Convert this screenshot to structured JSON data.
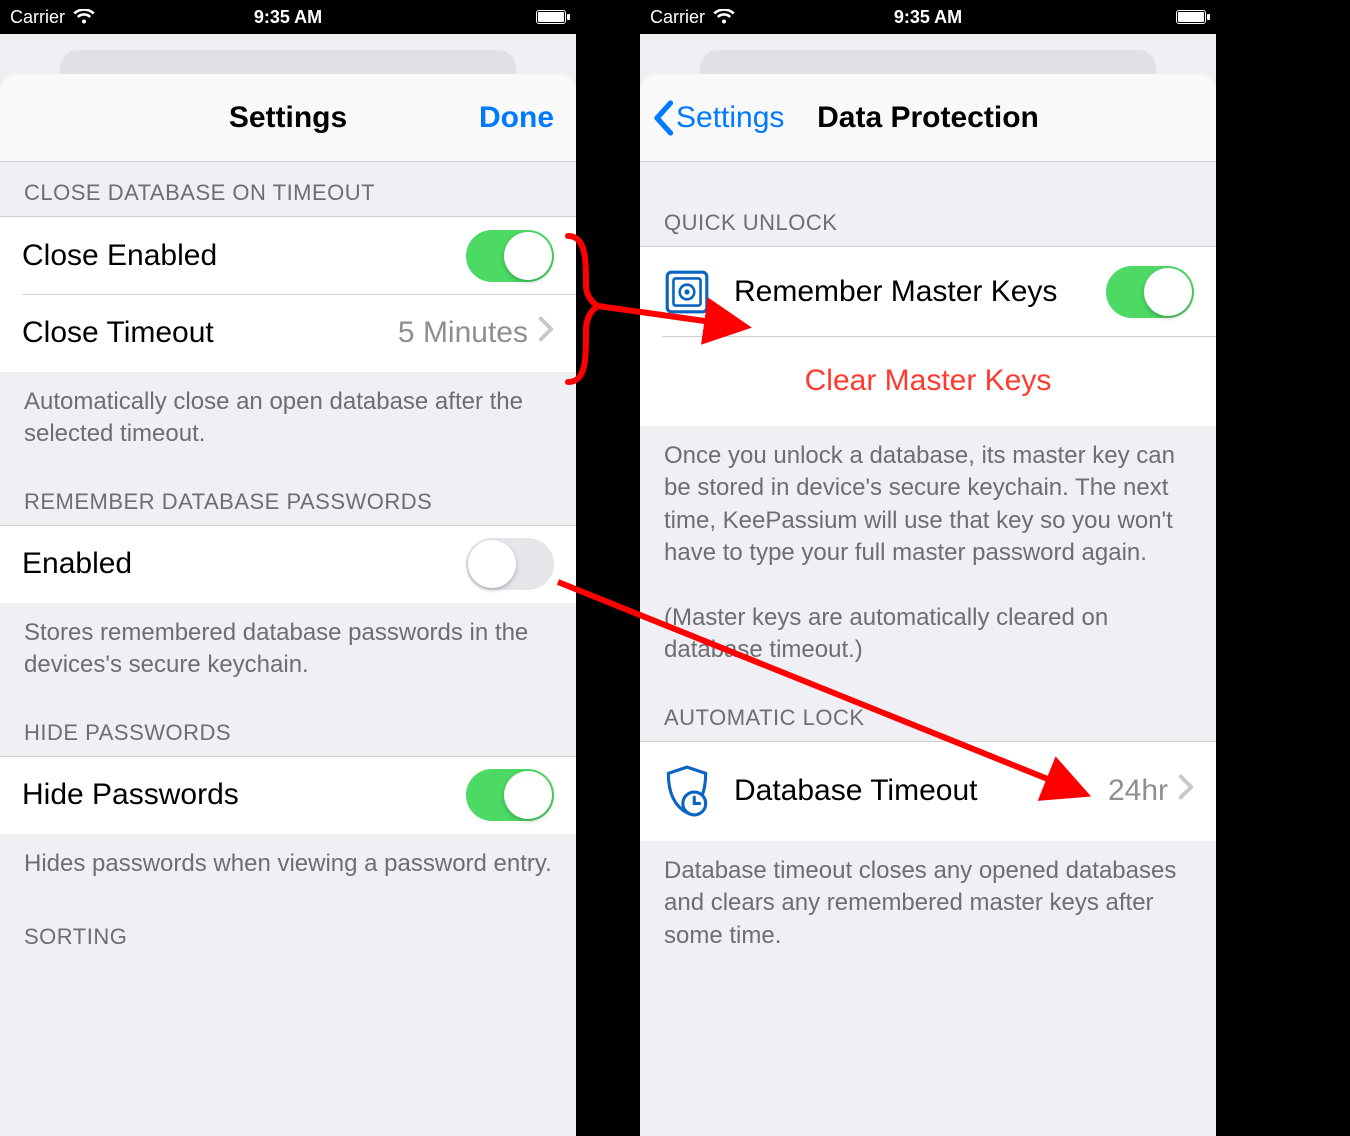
{
  "status": {
    "carrier": "Carrier",
    "time": "9:35 AM"
  },
  "left": {
    "nav": {
      "title": "Settings",
      "done": "Done"
    },
    "s1": {
      "header": "Close database on timeout",
      "row1_label": "Close Enabled",
      "row2_label": "Close Timeout",
      "row2_value": "5 Minutes",
      "footer": "Automatically close an open database after the selected timeout."
    },
    "s2": {
      "header": "Remember database passwords",
      "row1_label": "Enabled",
      "footer": "Stores remembered database passwords in the devices's secure keychain."
    },
    "s3": {
      "header": "Hide passwords",
      "row1_label": "Hide Passwords",
      "footer": "Hides passwords when viewing a password entry."
    },
    "s4": {
      "header": "Sorting"
    }
  },
  "right": {
    "nav": {
      "back": "Settings",
      "title": "Data Protection"
    },
    "s1": {
      "header": "Quick unlock",
      "row1_label": "Remember Master Keys",
      "row2_label": "Clear Master Keys",
      "footer1": "Once you unlock a database, its master key can be stored in device's secure keychain. The next time, KeePassium will use that key so you won't have to type your full master password again.",
      "footer2": "(Master keys are automatically cleared on database timeout.)"
    },
    "s2": {
      "header": "Automatic lock",
      "row1_label": "Database Timeout",
      "row1_value": "24hr",
      "footer": "Database timeout closes any opened databases and clears any remembered master keys after some time."
    }
  }
}
